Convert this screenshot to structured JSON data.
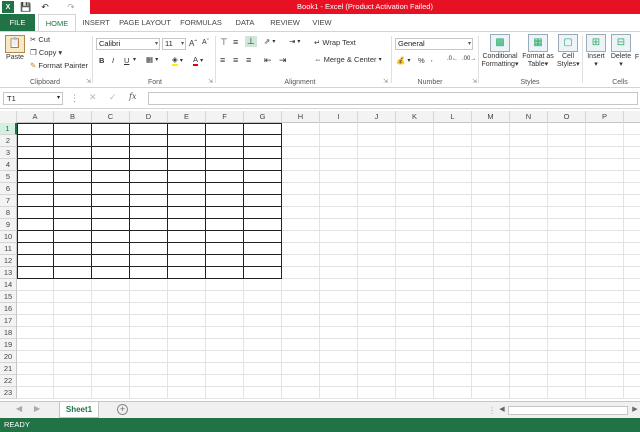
{
  "window": {
    "title": "Book1 - Excel (Product Activation Failed)"
  },
  "tabs": [
    "FILE",
    "HOME",
    "INSERT",
    "PAGE LAYOUT",
    "FORMULAS",
    "DATA",
    "REVIEW",
    "VIEW"
  ],
  "ribbon": {
    "clipboard": {
      "paste": "Paste",
      "cut": "Cut",
      "copy": "Copy",
      "format_painter": "Format Painter",
      "label": "Clipboard"
    },
    "font": {
      "name": "Calibri",
      "size": "11",
      "bold": "B",
      "italic": "I",
      "underline": "U",
      "label": "Font"
    },
    "alignment": {
      "wrap_text": "Wrap Text",
      "merge_center": "Merge & Center",
      "label": "Alignment"
    },
    "number": {
      "format": "General",
      "percent": "%",
      "label": "Number"
    },
    "styles": {
      "conditional": "Conditional",
      "conditional2": "Formatting",
      "format_as": "Format as",
      "table": "Table",
      "cell": "Cell",
      "styles_word": "Styles",
      "label": "Styles"
    },
    "cells": {
      "insert": "Insert",
      "delete": "Delete",
      "format": "F",
      "label": "Cells"
    }
  },
  "formula_bar": {
    "name_box": "T1",
    "fx": "fx",
    "value": ""
  },
  "grid": {
    "columns": [
      "A",
      "B",
      "C",
      "D",
      "E",
      "F",
      "G",
      "H",
      "I",
      "J",
      "K",
      "L",
      "M",
      "N",
      "O",
      "P"
    ],
    "rows": [
      "1",
      "2",
      "3",
      "4",
      "5",
      "6",
      "7",
      "8",
      "9",
      "10",
      "11",
      "12",
      "13",
      "14",
      "15",
      "16",
      "17",
      "18",
      "19",
      "20",
      "21",
      "22",
      "23"
    ],
    "selected_row": "1"
  },
  "sheets": {
    "active": "Sheet1",
    "add": "+"
  },
  "status": {
    "text": "READY"
  },
  "colors": {
    "excel_green": "#217346",
    "title_red": "#e81123"
  }
}
